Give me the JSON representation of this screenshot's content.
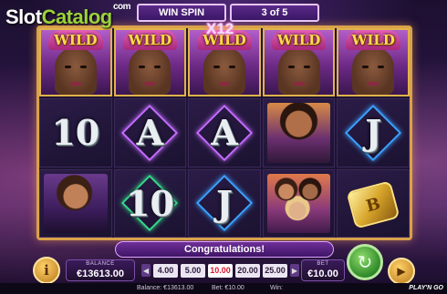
{
  "watermark": {
    "slot": "Slot",
    "catalog": "Catalog",
    "com": "com"
  },
  "header": {
    "win_spin": "WIN SPIN",
    "spin_count": "3 of 5",
    "multiplier": "X12"
  },
  "reels": {
    "row1": [
      "WILD",
      "WILD",
      "WILD",
      "WILD",
      "WILD"
    ],
    "row2": [
      "10",
      "A",
      "A",
      "woman-portrait",
      "J"
    ],
    "row3": [
      "woman-portrait",
      "10",
      "J",
      "group-portrait",
      "gold-ring"
    ]
  },
  "wild_label": "WILD",
  "ring_letter": "B",
  "congrats": "Congratulations!",
  "balance": {
    "label": "BALANCE",
    "value": "€13613.00"
  },
  "bet": {
    "label": "BET",
    "value": "€10.00"
  },
  "bet_options": [
    "4.00",
    "5.00",
    "10.00",
    "20.00",
    "25.00"
  ],
  "selected_bet": "10.00",
  "info_label": "i",
  "statusbar": {
    "balance": "Balance: €13613.00",
    "bet": "Bet: €10.00",
    "win": "Win:",
    "logo": "PLAY'N GO"
  },
  "colors": {
    "frame": "#d9a24a",
    "selected_bet": "#d6162d",
    "spin": "#2f8a2a"
  }
}
